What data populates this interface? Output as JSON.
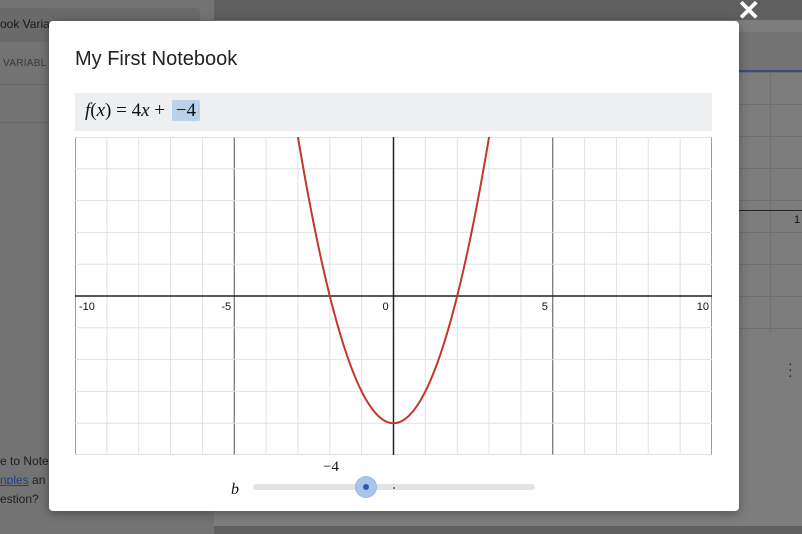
{
  "background": {
    "notebook_card_title": "ook Varia",
    "variables_label": "VARIABL",
    "welcome_lines": [
      "e to Note",
      "nples",
      " an",
      "estion? "
    ],
    "right_axis_tick": "1"
  },
  "modal": {
    "title": "My First Notebook",
    "close_symbol": "✕",
    "formula": {
      "lhs": "f",
      "arg": "x",
      "coefficient": "4",
      "variable": "x",
      "operator": "+",
      "parameter_value": "−4"
    },
    "slider": {
      "label": "b",
      "value": -4,
      "value_text": "−4",
      "min": -10,
      "max": 10
    }
  },
  "chart_data": {
    "type": "line",
    "xlim": [
      -10,
      10
    ],
    "ylim": [
      -5,
      5
    ],
    "x_ticks": [
      -10,
      -5,
      0,
      5,
      10
    ],
    "x_tick_labels": [
      "-10",
      "-5",
      "0",
      "5",
      "10"
    ],
    "grid": true,
    "series": [
      {
        "color": "#c0392b",
        "x": [
          -3.2,
          -3,
          -2.5,
          -2,
          -1.5,
          -1,
          -0.5,
          0,
          0.5,
          1,
          1.5,
          2,
          2.5,
          3,
          3.2
        ],
        "y": [
          6.24,
          5,
          2.25,
          0,
          -1.75,
          -3,
          -3.75,
          -4,
          -3.75,
          -3,
          -1.75,
          0,
          2.25,
          5,
          6.24
        ]
      }
    ],
    "colors": {
      "curve": "#c0392b",
      "grid": "#e2e2e2",
      "axis": "#222222"
    }
  }
}
